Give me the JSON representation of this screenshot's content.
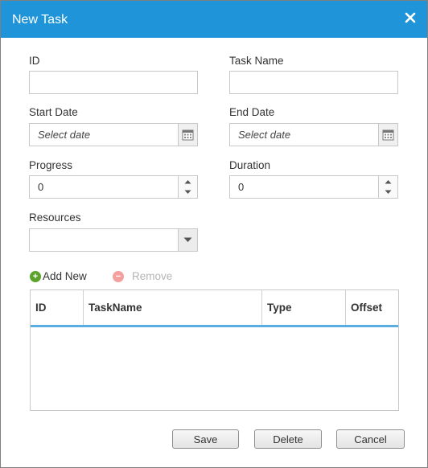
{
  "dialog": {
    "title": "New Task",
    "close_icon": "close-icon",
    "accent_color": "#1f94d8"
  },
  "form": {
    "id": {
      "label": "ID",
      "value": ""
    },
    "task_name": {
      "label": "Task Name",
      "value": ""
    },
    "start_date": {
      "label": "Start Date",
      "placeholder": "Select date",
      "icon": "calendar-icon"
    },
    "end_date": {
      "label": "End Date",
      "placeholder": "Select date",
      "icon": "calendar-icon"
    },
    "progress": {
      "label": "Progress",
      "value": "0"
    },
    "duration": {
      "label": "Duration",
      "value": "0"
    },
    "resources": {
      "label": "Resources",
      "value": ""
    }
  },
  "dependency_toolbar": {
    "add_label": "Add New",
    "remove_label": "Remove",
    "add_color": "#5ba32b",
    "remove_color": "#f4a0a0"
  },
  "dependency_grid": {
    "columns": [
      "ID",
      "TaskName",
      "Type",
      "Offset"
    ],
    "rows": []
  },
  "footer": {
    "save_label": "Save",
    "delete_label": "Delete",
    "cancel_label": "Cancel"
  }
}
